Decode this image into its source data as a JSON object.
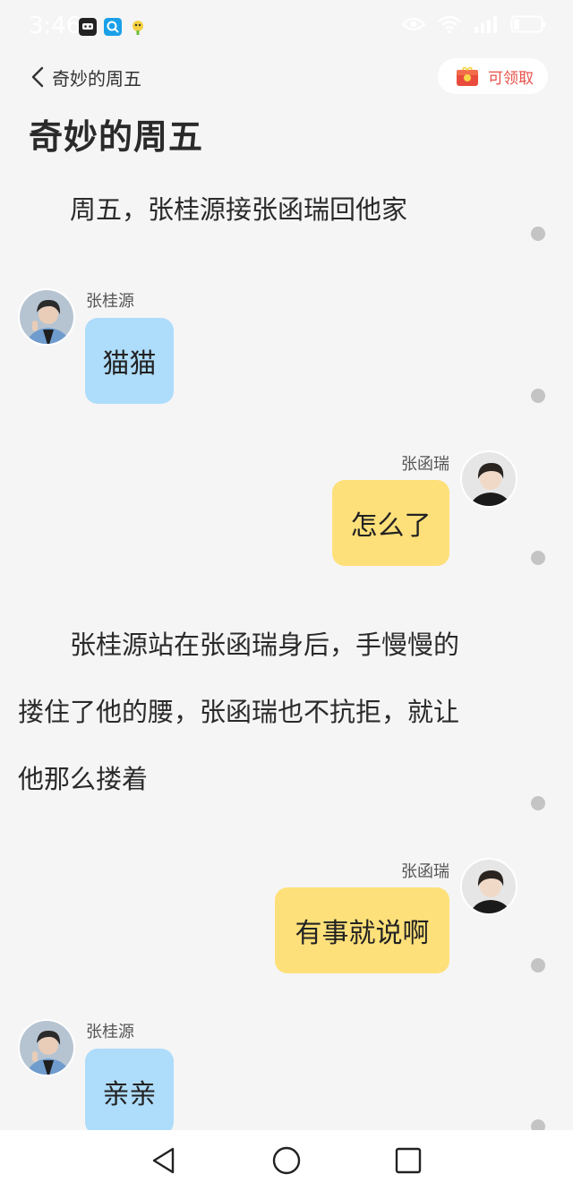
{
  "status_bar": {
    "time": "3:46",
    "app_icons": [
      "app-badge-icon",
      "search-app-icon",
      "bird-app-icon"
    ],
    "right_icons": [
      "eye-icon",
      "wifi-icon",
      "signal-icon",
      "battery-icon"
    ]
  },
  "header": {
    "back_label": "奇妙的周五",
    "claim_label": "可领取",
    "page_title": "奇妙的周五"
  },
  "story": {
    "narration_1": [
      "　　周五，张桂源接张函瑞回他家"
    ],
    "msg_1": {
      "speaker": "张桂源",
      "text": "猫猫"
    },
    "msg_2": {
      "speaker": "张函瑞",
      "text": "怎么了"
    },
    "narration_2": [
      "　　张桂源站在张函瑞身后，手慢慢的",
      "搂住了他的腰，张函瑞也不抗拒，就让",
      "他那么搂着"
    ],
    "msg_3": {
      "speaker": "张函瑞",
      "text": "有事就说啊"
    },
    "msg_4": {
      "speaker": "张桂源",
      "text": "亲亲"
    }
  },
  "colors": {
    "background": "#f5f5f5",
    "bubble_left": "#aedcfb",
    "bubble_right": "#fee07a",
    "claim_text": "#e8524a",
    "dot": "#c4c4c4"
  },
  "nav_bar": {
    "icons": [
      "back-triangle-icon",
      "home-circle-icon",
      "recents-square-icon"
    ]
  }
}
